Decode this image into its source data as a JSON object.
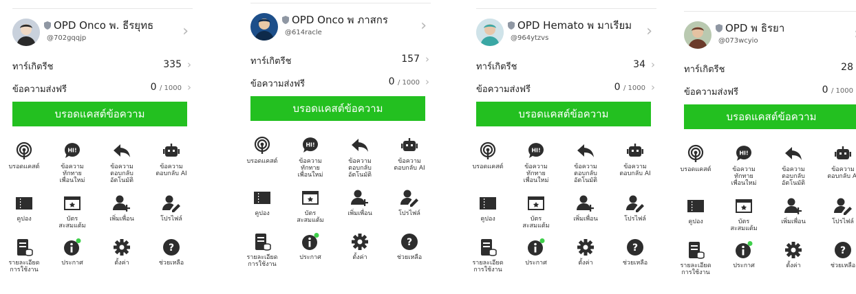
{
  "panels": [
    {
      "name": "OPD Onco พ. ธีรยุทธ",
      "id": "@702gqqjp",
      "friends_label": "ทาร์เกิตรีช",
      "friends_count": "335",
      "free_label": "ข้อความส่งฟรี",
      "free_used": "0",
      "free_total": "/ 1000",
      "broadcast_button": "บรอดแคสต์ข้อความ"
    },
    {
      "name": "OPD Onco พ ภาสกร",
      "id": "@614racle",
      "friends_label": "ทาร์เกิตรีช",
      "friends_count": "157",
      "free_label": "ข้อความส่งฟรี",
      "free_used": "0",
      "free_total": "/ 1000",
      "broadcast_button": "บรอดแคสต์ข้อความ"
    },
    {
      "name": "OPD Hemato พ มาเรียม",
      "id": "@964ytzvs",
      "friends_label": "ทาร์เกิตรีช",
      "friends_count": "34",
      "free_label": "ข้อความส่งฟรี",
      "free_used": "0",
      "free_total": "/ 1000",
      "broadcast_button": "บรอดแคสต์ข้อความ"
    },
    {
      "name": "OPD พ ธิรยา",
      "id": "@073wcyio",
      "friends_label": "ทาร์เกิตรีช",
      "friends_count": "28",
      "free_label": "ข้อความส่งฟรี",
      "free_used": "0",
      "free_total": "/ 1000",
      "broadcast_button": "บรอดแคสต์ข้อความ"
    }
  ],
  "menu": [
    {
      "label": "บรอดแคสต์",
      "icon": "broadcast-icon"
    },
    {
      "label": "ข้อความ\nทักทาย\nเพื่อนใหม่",
      "icon": "hi-greeting-icon"
    },
    {
      "label": "ข้อความ\nตอบกลับ\nอัตโนมัติ",
      "icon": "auto-reply-icon"
    },
    {
      "label": "ข้อความ\nตอบกลับ AI",
      "icon": "ai-bot-icon"
    },
    {
      "label": "คูปอง",
      "icon": "coupon-icon"
    },
    {
      "label": "บัตร\nสะสมแต้ม",
      "icon": "reward-card-icon"
    },
    {
      "label": "เพิ่มเพื่อน",
      "icon": "add-friend-icon"
    },
    {
      "label": "โปรไฟล์",
      "icon": "profile-edit-icon"
    },
    {
      "label": "รายละเอียด\nการใช้งาน",
      "icon": "usage-details-icon"
    },
    {
      "label": "ประกาศ",
      "icon": "announcement-icon"
    },
    {
      "label": "ตั้งค่า",
      "icon": "settings-gear-icon"
    },
    {
      "label": "ช่วยเหลือ",
      "icon": "help-icon"
    }
  ],
  "colors": {
    "accent_green": "#23c020",
    "icon_dark": "#2d2d2d",
    "badge_green": "#3fcf4b"
  }
}
